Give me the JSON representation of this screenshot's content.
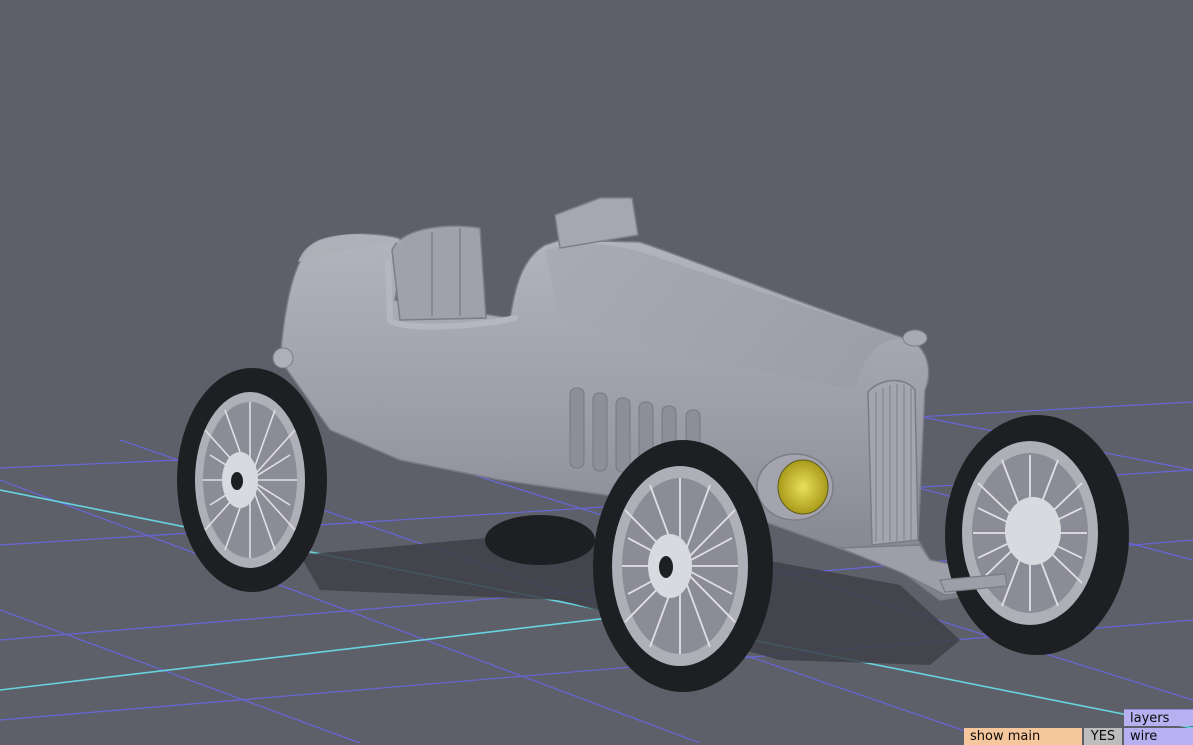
{
  "viewport": {
    "background_color": "#5d6068",
    "model": "vintage open-wheel race car",
    "grid_color": "#6a66e6",
    "axis_color": "#67d3e0",
    "body_color": "#9b9ca6",
    "tire_color": "#1e1f22",
    "headlight_color": "#d6c812"
  },
  "controls": {
    "layers_label": "layers",
    "wire_label": "wire",
    "show_main_label": "show main",
    "show_main_value": "YES"
  }
}
